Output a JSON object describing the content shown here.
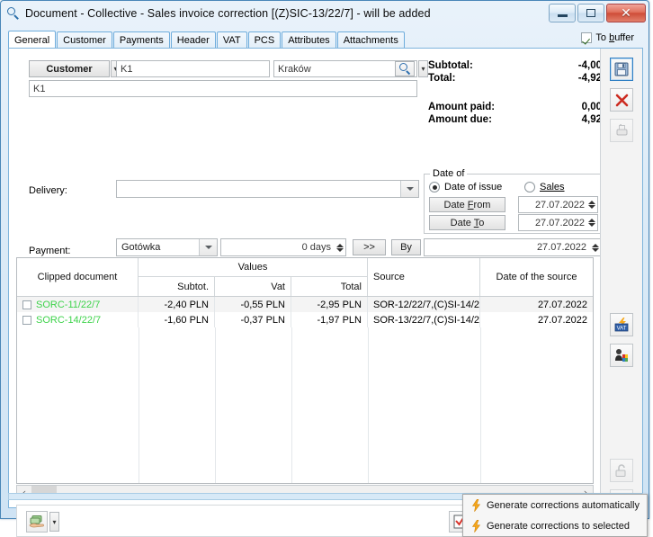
{
  "window": {
    "title": "Document - Collective - Sales invoice correction [(Z)SIC-13/22/7]  - will be added",
    "search_icon": "magnifier-icon",
    "minimize_label": "—",
    "maximize_label": "□",
    "close_label": "✕"
  },
  "tabs": [
    {
      "label": "General",
      "active": true
    },
    {
      "label": "Customer",
      "active": false
    },
    {
      "label": "Payments",
      "active": false
    },
    {
      "label": "Header",
      "active": false
    },
    {
      "label": "VAT",
      "active": false
    },
    {
      "label": "PCS",
      "active": false
    },
    {
      "label": "Attributes",
      "active": false
    },
    {
      "label": "Attachments",
      "active": false
    }
  ],
  "to_buffer": {
    "label_pre": "To ",
    "label_accel": "b",
    "label_post": "uffer",
    "checked": true
  },
  "form": {
    "customer_button": "Customer",
    "customer_code": "K1",
    "customer_city": "Kraków",
    "customer_name": "K1",
    "delivery_label": "Delivery:",
    "delivery_value": "",
    "payment_label": "Payment:",
    "payment_method": "Gotówka",
    "payment_days": "0 days",
    "forward_button": ">>",
    "by_button": "By",
    "payment_date": "27.07.2022"
  },
  "summary": {
    "subtotal_label": "Subtotal:",
    "subtotal_value": "-4,00",
    "total_label": "Total:",
    "total_value": "-4,92",
    "paid_label": "Amount paid:",
    "paid_value": "0,00",
    "due_label": "Amount due:",
    "due_value": "4,92"
  },
  "date_of": {
    "group_title": "Date of",
    "radio_issue": "Date of issue",
    "radio_issue_selected": true,
    "radio_sales": "Sales",
    "radio_sales_selected": false,
    "date_from_label_pre": "Date ",
    "date_from_accel": "F",
    "date_from_label_post": "rom",
    "date_from_value": "27.07.2022",
    "date_to_label_pre": "Date ",
    "date_to_accel": "T",
    "date_to_label_post": "o",
    "date_to_value": "27.07.2022"
  },
  "grid": {
    "headers": {
      "clipped_document": "Clipped document",
      "values_group": "Values",
      "subtotal": "Subtot.",
      "vat": "Vat",
      "total": "Total",
      "source": "Source",
      "date_of_source": "Date of the source"
    },
    "rows": [
      {
        "checked": false,
        "document": "SORC-11/22/7",
        "subtotal": "-2,40 PLN",
        "vat": "-0,55 PLN",
        "total": "-2,95 PLN",
        "source": "SOR-12/22/7,(C)SI-14/2",
        "date": "27.07.2022"
      },
      {
        "checked": false,
        "document": "SORC-14/22/7",
        "subtotal": "-1,60 PLN",
        "vat": "-0,37 PLN",
        "total": "-1,97 PLN",
        "source": "SOR-13/22/7,(C)SI-14/2",
        "date": "27.07.2022"
      }
    ]
  },
  "scrollbar": {
    "left_arrow": "‹",
    "right_arrow": "›"
  },
  "bottom_toolbar": {
    "payments_icon": "money-hand-icon",
    "payments_caret": "▾",
    "confirm_icon": "checkmark-box-icon",
    "generate_icon": "lightning-bolt-icon",
    "generate_caret": "▾",
    "open_icon": "open-document-icon",
    "close_icon": "close-document-icon",
    "preview_icon": "magnifier-icon",
    "delete_icon": "trash-icon"
  },
  "right_toolbar": {
    "save_icon": "save-disk-icon",
    "cancel_icon": "red-x-icon",
    "print_icon": "print-icon",
    "vat_icon": "vat-icon",
    "contractor_icon": "contractor-icon",
    "lock_icon": "padlock-icon",
    "misc_icon": "document-icon"
  },
  "context_menu": {
    "items": [
      {
        "icon": "lightning-bolt-icon",
        "label": "Generate corrections automatically"
      },
      {
        "icon": "lightning-bolt-icon",
        "label": "Generate corrections to selected"
      }
    ]
  },
  "colors": {
    "accent": "#4a87b8",
    "row_text_green": "#3dd34a",
    "title_bg": "#dcebf7",
    "close_btn": "#cf4d38",
    "bolt": "#f5a623"
  }
}
